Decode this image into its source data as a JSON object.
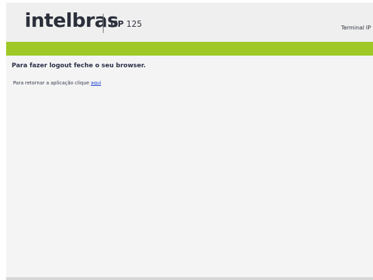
{
  "header": {
    "logo_text": "intelbras",
    "model_prefix": "TIP",
    "model_number": " 125",
    "terminal_label": "Terminal IP"
  },
  "colors": {
    "accent_green": "#9ec825",
    "link_blue": "#1a3fd0"
  },
  "content": {
    "logout_message": "Para fazer logout feche o seu browser.",
    "return_prefix": "Para retornar a aplicação clique ",
    "return_link": "aqui"
  }
}
